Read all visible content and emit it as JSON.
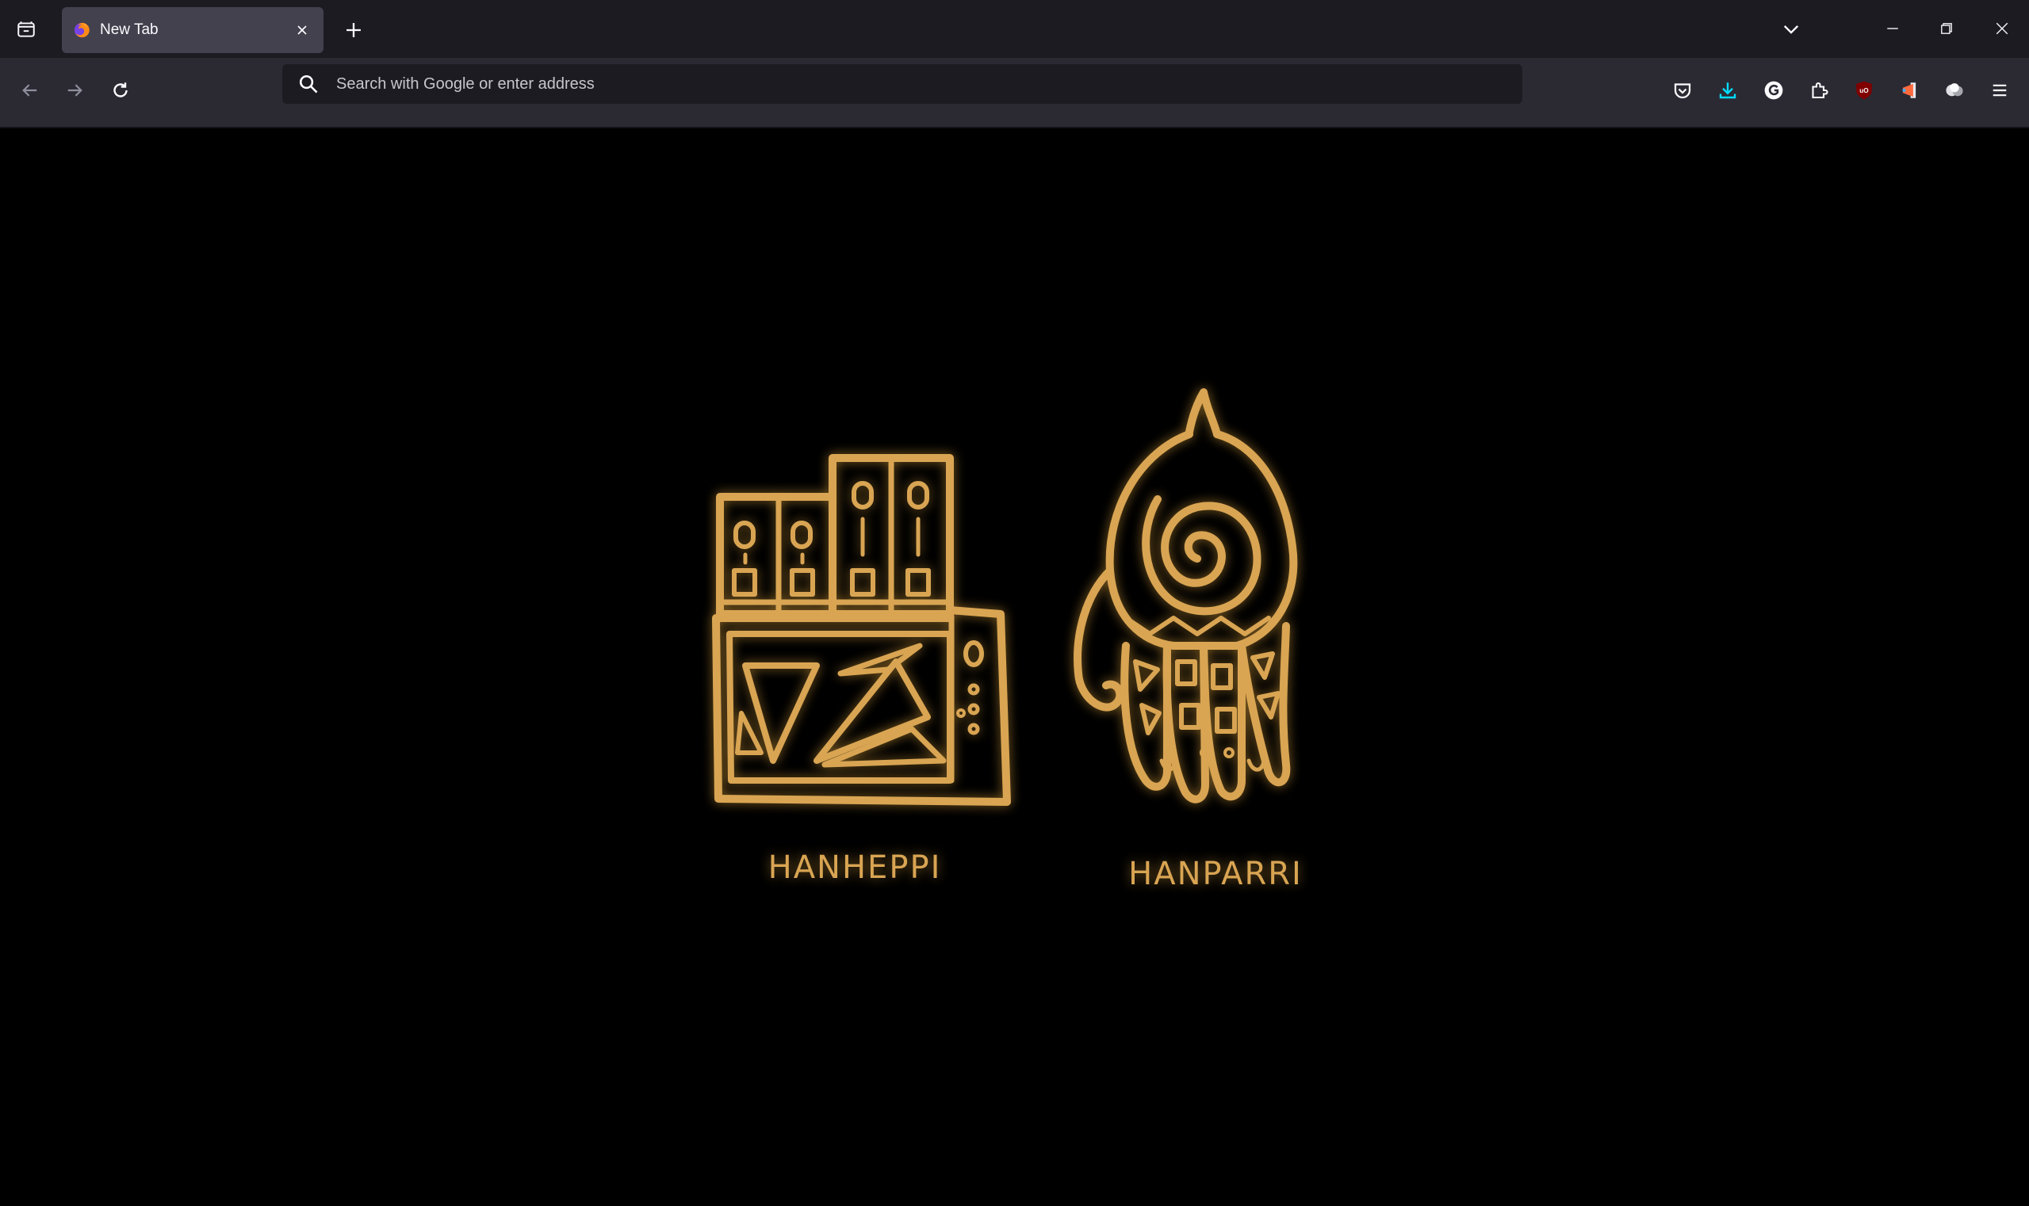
{
  "tab": {
    "title": "New Tab",
    "close_label": "Close Tab"
  },
  "urlbar": {
    "placeholder": "Search with Google or enter address",
    "value": ""
  },
  "toolbar": {
    "icons": [
      "pocket-icon",
      "downloads-icon",
      "grammarly-icon",
      "extensions-icon",
      "ublock-origin-icon",
      "extension-icon",
      "extension-cloud-icon",
      "menu-icon"
    ]
  },
  "artwork": {
    "left_label": "HANHEPPI",
    "right_label": "HANPARRI",
    "glyph_color": "#d9a552",
    "glow_color": "#f0b040",
    "background_color": "#000000"
  },
  "colors": {
    "tabstrip_bg": "#1c1b22",
    "navbar_bg": "#2b2a33",
    "selected_tab_bg": "#42414d",
    "downloads_accent": "#00ddff",
    "ublock_red": "#800000"
  }
}
